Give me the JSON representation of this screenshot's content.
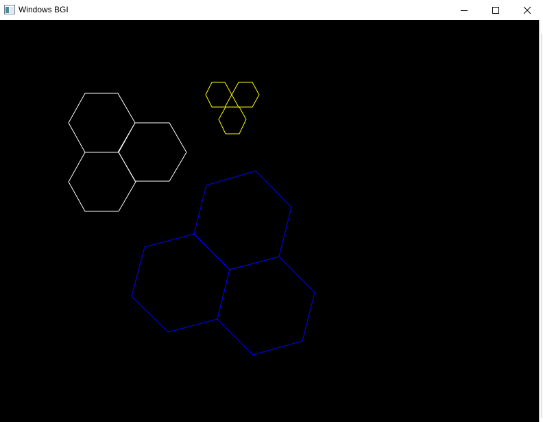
{
  "window": {
    "title": "Windows BGI",
    "controls": [
      "minimize",
      "maximize",
      "close"
    ]
  },
  "canvas": {
    "background": "#000000",
    "groups": [
      {
        "name": "white-hexagon-cluster",
        "color": "#ffffff",
        "count": 3
      },
      {
        "name": "yellow-hexagon-cluster",
        "color": "#ffff00",
        "count": 3
      },
      {
        "name": "blue-hexagon-cluster",
        "color": "#0000ff",
        "count": 3
      }
    ]
  }
}
